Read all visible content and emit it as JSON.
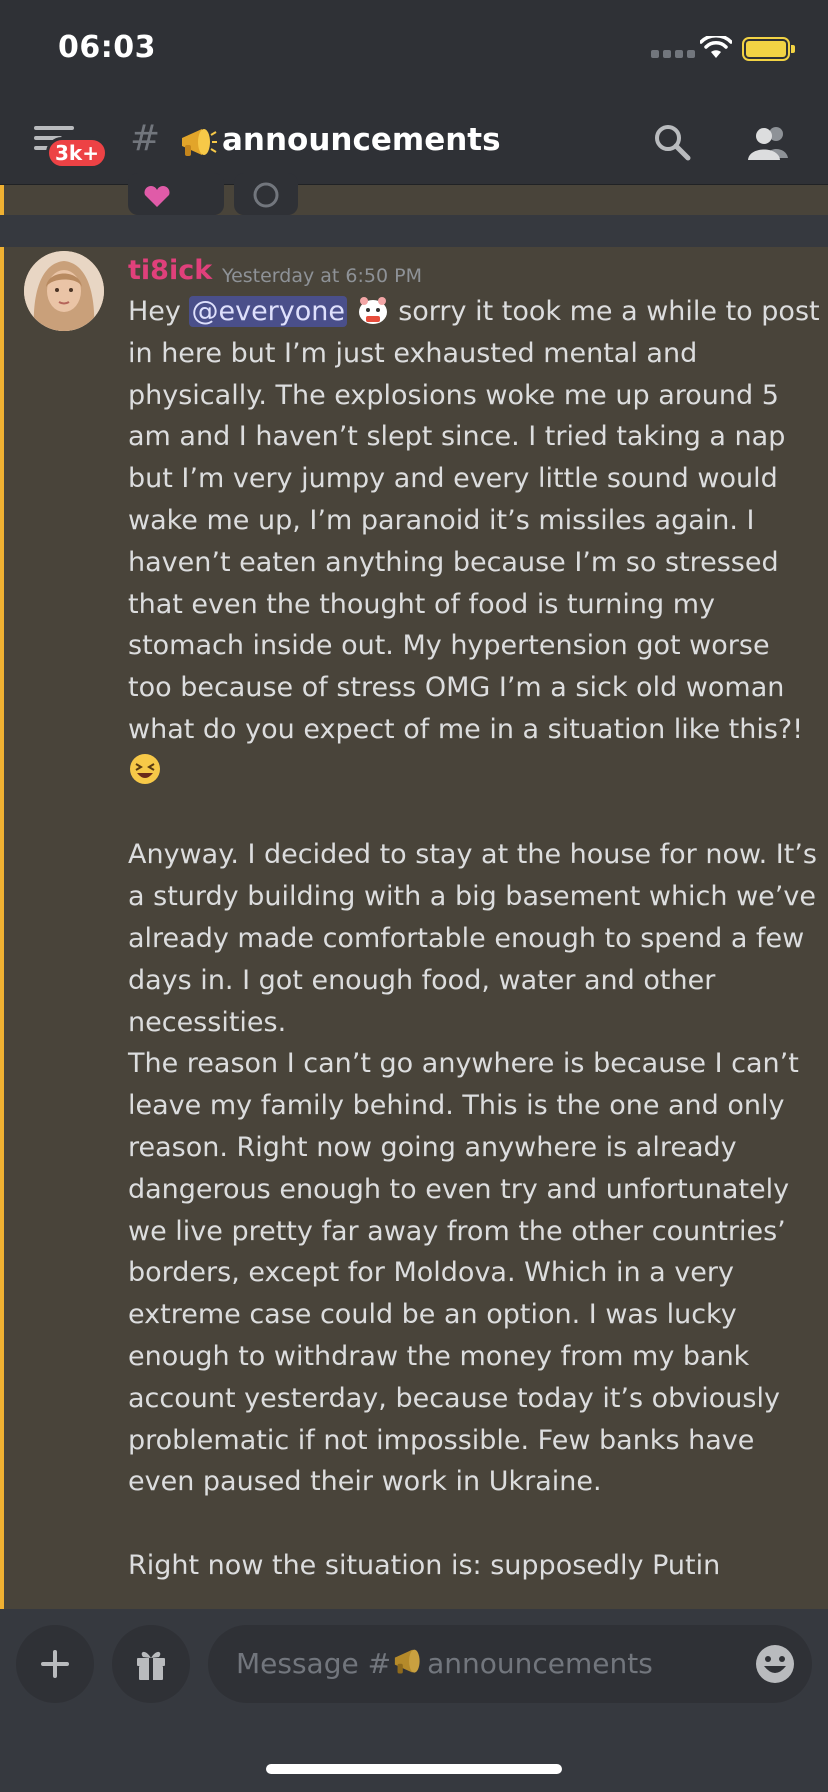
{
  "status_bar": {
    "time": "06:03"
  },
  "header": {
    "badge": "3k+",
    "channel_hash": "#",
    "channel_emoji": "megaphone-icon",
    "channel_name": "announcements"
  },
  "message": {
    "author": "ti8ick",
    "author_color": "#e0407b",
    "timestamp": "Yesterday at 6:50 PM",
    "mention": "@everyone",
    "line1_after_mention": " sorry it took me a while to post",
    "lines_block1": [
      "in here but I’m just exhausted mental and",
      "physically. The explosions woke me up around 5",
      "am and I haven’t slept since. I tried taking a nap",
      "but I’m very jumpy and every little sound would",
      "wake me up, I’m paranoid it’s missiles again. I",
      "haven’t eaten anything because I’m so stressed",
      "that even the thought of food is turning my",
      "stomach inside out. My hypertension got worse",
      "too because of stress OMG I’m a sick old woman",
      "what do you expect of me in a situation like this?!"
    ],
    "lines_block2": [
      "Anyway. I decided to stay at the house for now. It’s",
      "a sturdy building with a big basement which we’ve",
      "already made comfortable enough to spend a few",
      "days in. I got enough food, water and other",
      "necessities.",
      "The reason I can’t go anywhere is because I can’t",
      "leave my family behind. This is the one and only",
      "reason. Right now going anywhere is already",
      "dangerous enough to even try and unfortunately",
      "we live pretty far away from the other countries’",
      "borders, except for Moldova. Which in a very",
      "extreme case could be an option. I was lucky",
      "enough to withdraw the money from my bank",
      "account yesterday, because today it’s obviously",
      "problematic if not impossible. Few banks have",
      "even paused their work in Ukraine."
    ],
    "lines_block3": [
      "Right now the situation is: supposedly Putin"
    ]
  },
  "composer": {
    "placeholder_prefix": "Message #",
    "placeholder_channel": "announcements"
  },
  "colors": {
    "background": "#36393f",
    "header_bg": "#2f3136",
    "highlight_bg": "#49443a",
    "highlight_bar": "#f0b132",
    "mention_bg": "#4a4f8a",
    "badge": "#ed4245"
  }
}
